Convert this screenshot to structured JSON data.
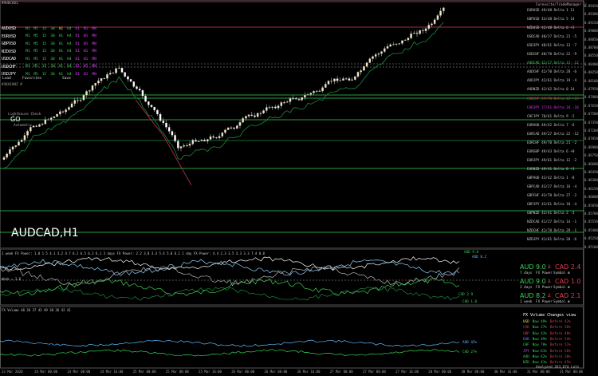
{
  "chart": {
    "symbol_title": "AUDCAD,H1",
    "header_mini": "#AUDCAD1",
    "account": "#1KA1982 #"
  },
  "symbols": [
    {
      "name": "AUDUSD",
      "active": true
    },
    {
      "name": "EURUSD",
      "active": false
    },
    {
      "name": "GBPUSD",
      "active": false
    },
    {
      "name": "NZDUSD",
      "active": false
    },
    {
      "name": "USDCAD",
      "active": false
    },
    {
      "name": "USDCHF",
      "active": false
    },
    {
      "name": "USDJPY",
      "active": false
    }
  ],
  "timeframes": [
    "M1",
    "M5",
    "15",
    "30",
    "H1",
    "H4",
    "D1",
    "W1",
    "MN"
  ],
  "buttons": {
    "load": "Load",
    "favorites": "Favorites",
    "save": "Save"
  },
  "lighthouse": {
    "title": "Lighthouse Check",
    "go": "GO",
    "mode": "Automatic"
  },
  "pair_list_header": "Forexsite/TradeManager ⓘ",
  "pairs": [
    {
      "label": "EURUSD 49/48 Delta  1  11",
      "color": "#c8c8c8"
    },
    {
      "label": "GBPUSD 43/48 Delta  5  14",
      "color": "#c8c8c8"
    },
    {
      "label": "NZDUSD 42/48 Delta  6  +3",
      "color": "#c8c8c8"
    },
    {
      "label": "USDCAD 48/27 Delta 21  -5",
      "color": "#c8c8c8"
    },
    {
      "label": "USDJPY 48/61 Delta 13  -7",
      "color": "#c8c8c8"
    },
    {
      "label": "USDCHF 48/70 Delta 22  -9",
      "color": "#c8c8c8"
    },
    {
      "label": "AUDCAD 42/27 Delta 13 -12",
      "color": "#39d353"
    },
    {
      "label": "AUDCHF 42/70 Delta 28  -6",
      "color": "#c8c8c8"
    },
    {
      "label": "AUDJPY 42/61 Delta 19  -4",
      "color": "#c8c8c8"
    },
    {
      "label": "AUDNZD 42/42 Delta  0  14",
      "color": "#c8c8c8"
    },
    {
      "label": "CADCHF 27/70 Delta 43 -15",
      "color": "#e03c50"
    },
    {
      "label": "CADJPY 27/61 Delta 34 -18",
      "color": "#e03cff"
    },
    {
      "label": "CHFJPY 70/61 Delta  9  -2",
      "color": "#c8c8c8"
    },
    {
      "label": "EURAUD 49/42 Delta  7  -6",
      "color": "#c8c8c8"
    },
    {
      "label": "EURCAD 49/27 Delta 22 -12",
      "color": "#c8c8c8"
    },
    {
      "label": "EURCHF 49/70 Delta 21  -2",
      "color": "#c8c8c8"
    },
    {
      "label": "EURGBP 49/43 Delta  6  +0",
      "color": "#c8c8c8"
    },
    {
      "label": "EURJPY 49/61 Delta 12  -2",
      "color": "#c8c8c8"
    },
    {
      "label": "EURNZD 49/41 Delta  8  +3",
      "color": "#c8c8c8"
    },
    {
      "label": "GBPAUD 43/42 Delta  1  -8",
      "color": "#c8c8c8"
    },
    {
      "label": "GBPCAD 43/27 Delta 16  -4",
      "color": "#c8c8c8"
    },
    {
      "label": "GBPCHF 43/70 Delta 27  -2",
      "color": "#c8c8c8"
    },
    {
      "label": "GBPJPY 43/61 Delta 18  -4",
      "color": "#c8c8c8"
    },
    {
      "label": "GBPNZD 43/41 Delta  2  -3",
      "color": "#c8c8c8"
    },
    {
      "label": "NZDCAD 41/27 Delta 14  -1",
      "color": "#c8c8c8"
    },
    {
      "label": "NZDCHF 41/70 Delta 29  -1",
      "color": "#c8c8c8"
    },
    {
      "label": "NZDJPY 41/61 Delta 20  -6",
      "color": "#c8c8c8"
    }
  ],
  "price_axis": [
    "0.89450",
    "0.89300",
    "0.89150",
    "0.89000",
    "0.88850",
    "0.88700",
    "0.88550",
    "0.88400",
    "0.88250",
    "0.88100",
    "0.87950",
    "0.87800",
    "0.87650",
    "0.87500",
    "0.87350",
    "0.87200",
    "0.87050",
    "0.86900",
    "0.86750",
    "0.86600",
    "0.86450",
    "0.86300",
    "0.86150",
    "0.86000",
    "0.85850",
    "0.85700",
    "0.85550",
    "0.85400",
    "0.85250",
    "0.85100"
  ],
  "time_axis": [
    "23 Mar 2020",
    "24 Mar 00:00",
    "24 Mar 08:00",
    "24 Mar 16:00",
    "25 Mar 00:00",
    "25 Mar 08:00",
    "25 Mar 16:00",
    "26 Mar 00:00",
    "26 Mar 08:00",
    "26 Mar 16:00",
    "27 Mar 00:00",
    "27 Mar 08:00",
    "27 Mar 16:00",
    "28 Mar 00:00",
    "30 Mar 08:00",
    "30 Mar 16:00",
    "31 Mar 00:00",
    "31 Mar 08:00"
  ],
  "fx_power": {
    "title": "1 week FX Power: 1.8 1.5 4.1 3.2 4.7 6.2 6.5 6.2 6.1    3 days FX Power: 2.2 3.8 3.3 5.4 5.0 6.1    1 day FX Power: 4.4 2.3 3.5 3.3 3.3 7.4 8.8",
    "blocks": [
      {
        "a": "AUD 9.0",
        "b": "CAD 2.4",
        "period": "7 days",
        "label": "FX Power",
        "sym": "Symbol"
      },
      {
        "a": "AUD 9.0",
        "b": "CAD 1.0",
        "period": "3 days",
        "label": "FX Power",
        "sym": "Symbol"
      },
      {
        "a": "AUD 8.2",
        "b": "CAD 2.1",
        "period": "1 week",
        "label": "FX Power",
        "sym": "Symbol"
      }
    ],
    "line_labels": [
      "AUD 9.0",
      "AUD 8.2",
      "CAD 2.9",
      "CAD 1.0"
    ],
    "mid_label": "Week = 3.0"
  },
  "fx_volume": {
    "title": "FX Volume  48 36 37 43 49 38 36 42 41",
    "header": "FX Volume Changes view",
    "rows": [
      {
        "ccy": "USD",
        "now": "Now 49%",
        "before": "Before 42%",
        "color": "#e8e83a"
      },
      {
        "ccy": "CAD",
        "now": "Now 27%",
        "before": "Before 50%",
        "color": "#e03c50"
      },
      {
        "ccy": "GBP",
        "now": "Now 43%",
        "before": "Before 48%",
        "color": "#e03c50"
      },
      {
        "ccy": "EUR",
        "now": "Now 49%",
        "before": "Before 54%",
        "color": "#5a8cff"
      },
      {
        "ccy": "CHF",
        "now": "Now 70%",
        "before": "Before 51%",
        "color": "#39d353"
      },
      {
        "ccy": "JPY",
        "now": "Now 61%",
        "before": "Before 56%",
        "color": "#e03cff"
      },
      {
        "ccy": "AUD",
        "now": "Now 42%",
        "before": "Before 38%",
        "color": "#39d353"
      },
      {
        "ccy": "NZD",
        "now": "Now 41%",
        "before": "Before 45%",
        "color": "#39d353"
      }
    ],
    "footer": "Analyzed 263,674 Lots",
    "line_labels": [
      "AUD 42%",
      "CAD 27%"
    ]
  },
  "colors": {
    "bull": "#f2e9c4",
    "bear": "#ffffff",
    "green": "#39d353",
    "red": "#e03c50",
    "magenta": "#e03cff"
  }
}
